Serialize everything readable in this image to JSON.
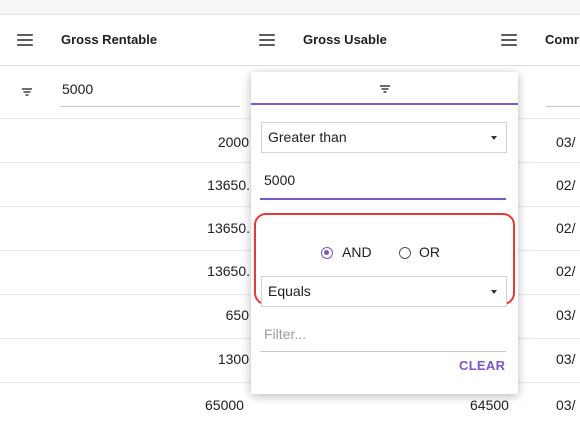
{
  "columns": [
    {
      "label": "Gross Rentable"
    },
    {
      "label": "Gross Usable"
    },
    {
      "label": "Comr"
    }
  ],
  "filter_row": {
    "value": "5000"
  },
  "rows": [
    {
      "gross_rentable": "2000",
      "comm": "03/"
    },
    {
      "gross_rentable": "13650.",
      "comm": "02/"
    },
    {
      "gross_rentable": "13650.",
      "comm": "02/"
    },
    {
      "gross_rentable": "13650.",
      "comm": "02/"
    },
    {
      "gross_rentable": "650",
      "comm": "03/"
    },
    {
      "gross_rentable": "1300",
      "comm": "03/"
    },
    {
      "gross_rentable": "65000",
      "gross_usable": "64500",
      "comm": "03/"
    }
  ],
  "popup": {
    "condition1": {
      "operator": "Greater than",
      "value": "5000"
    },
    "join": {
      "and_label": "AND",
      "or_label": "OR",
      "selected": "AND"
    },
    "condition2": {
      "operator": "Equals",
      "placeholder": "Filter..."
    },
    "clear_label": "CLEAR"
  },
  "colors": {
    "accent": "#7e57c2",
    "highlight": "#e53935"
  }
}
